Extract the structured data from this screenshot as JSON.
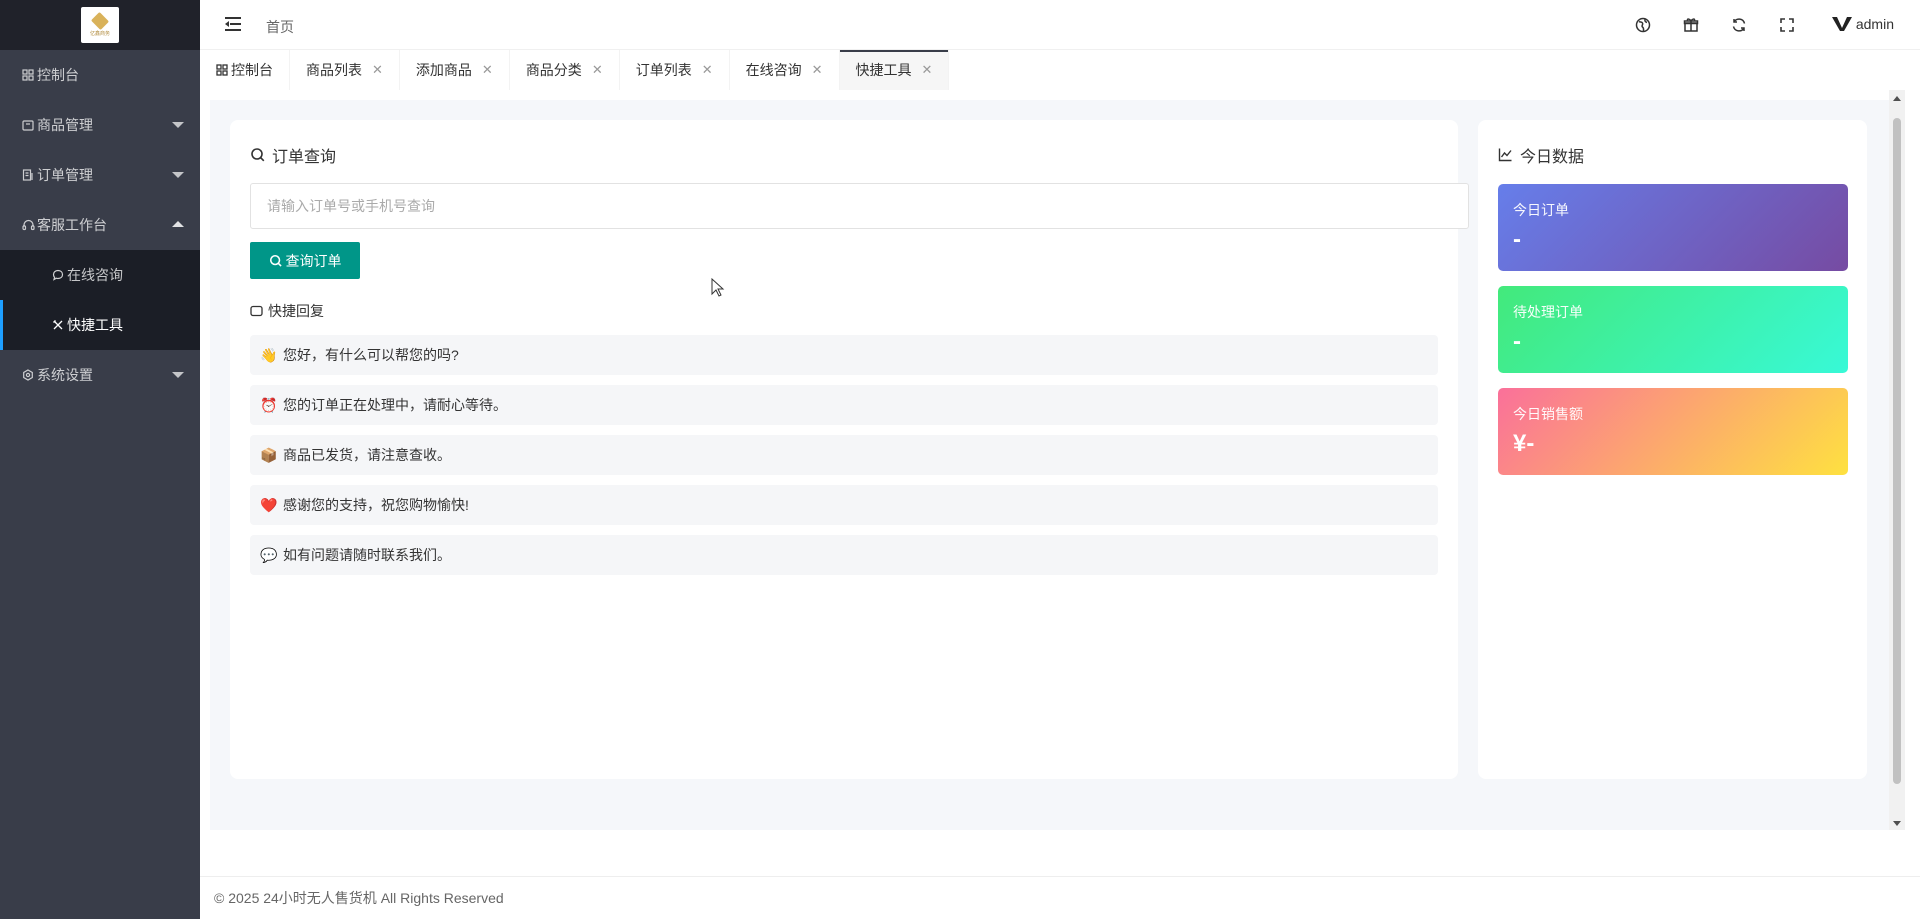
{
  "sidebar": {
    "logo_text": "亿鑫商务",
    "items": [
      {
        "label": "控制台",
        "icon": "dashboard-icon"
      },
      {
        "label": "商品管理",
        "icon": "box-icon"
      },
      {
        "label": "订单管理",
        "icon": "order-icon"
      },
      {
        "label": "客服工作台",
        "icon": "headset-icon"
      },
      {
        "label": "系统设置",
        "icon": "gear-icon"
      }
    ],
    "sub_items": [
      {
        "label": "在线咨询",
        "icon": "chat-bubble-icon"
      },
      {
        "label": "快捷工具",
        "icon": "tools-icon"
      }
    ]
  },
  "header": {
    "breadcrumb": "首页",
    "username": "admin"
  },
  "tabs": [
    {
      "label": "控制台"
    },
    {
      "label": "商品列表"
    },
    {
      "label": "添加商品"
    },
    {
      "label": "商品分类"
    },
    {
      "label": "订单列表"
    },
    {
      "label": "在线咨询"
    },
    {
      "label": "快捷工具"
    }
  ],
  "order_query": {
    "title": "订单查询",
    "placeholder": "请输入订单号或手机号查询",
    "button_label": "查询订单"
  },
  "quick_reply": {
    "title": "快捷回复",
    "items": [
      {
        "emoji": "👋",
        "text": "您好，有什么可以帮您的吗?"
      },
      {
        "emoji": "⏰",
        "text": "您的订单正在处理中，请耐心等待。"
      },
      {
        "emoji": "📦",
        "text": "商品已发货，请注意查收。"
      },
      {
        "emoji": "❤️",
        "text": "感谢您的支持，祝您购物愉快!"
      },
      {
        "emoji": "💬",
        "text": "如有问题请随时联系我们。"
      }
    ]
  },
  "today_data": {
    "title": "今日数据",
    "stats": [
      {
        "label": "今日订单",
        "value": "-"
      },
      {
        "label": "待处理订单",
        "value": "-"
      },
      {
        "label": "今日销售额",
        "value": "¥-"
      }
    ]
  },
  "footer": {
    "text": "© 2025 24小时无人售货机 All Rights Reserved"
  },
  "colors": {
    "sidebar_bg": "#393d49",
    "sidebar_dark": "#20222a",
    "primary_button": "#009688",
    "active_indicator": "#1e9fff"
  }
}
